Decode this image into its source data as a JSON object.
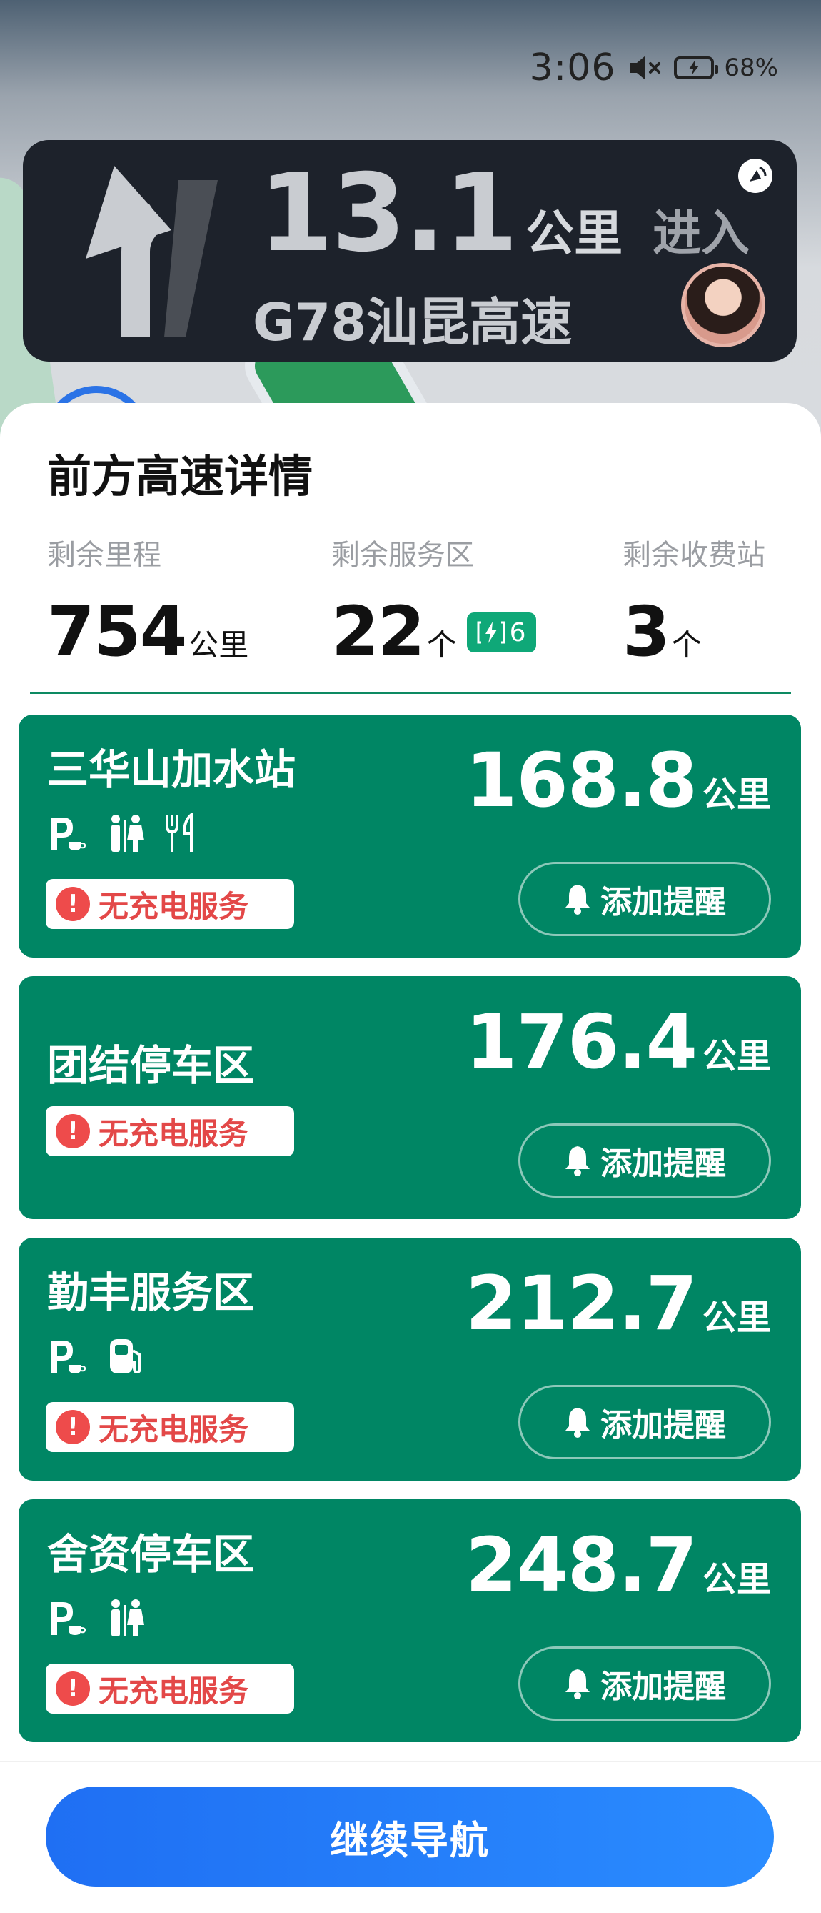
{
  "status_bar": {
    "time": "3:06",
    "battery_percent": "68%"
  },
  "navigation": {
    "distance_value": "13.1",
    "distance_unit": "公里",
    "action": "进入",
    "road_name": "G78汕昆高速",
    "turn_icon": "turn-left-arrow-icon"
  },
  "sheet": {
    "title": "前方高速详情",
    "stats": [
      {
        "label": "剩余里程",
        "value": "754",
        "unit": "公里"
      },
      {
        "label": "剩余服务区",
        "value": "22",
        "unit": "个",
        "charging_count": "6"
      },
      {
        "label": "剩余收费站",
        "value": "3",
        "unit": "个"
      }
    ]
  },
  "stations": [
    {
      "name": "三华山加水站",
      "distance": "168.8",
      "unit": "公里",
      "facilities": [
        "parking-icon",
        "restroom-icon",
        "restaurant-icon"
      ],
      "charge_status": "无充电服务",
      "remind_label": "添加提醒"
    },
    {
      "name": "团结停车区",
      "distance": "176.4",
      "unit": "公里",
      "facilities": [],
      "charge_status": "无充电服务",
      "remind_label": "添加提醒"
    },
    {
      "name": "勤丰服务区",
      "distance": "212.7",
      "unit": "公里",
      "facilities": [
        "parking-icon",
        "gas-station-icon"
      ],
      "charge_status": "无充电服务",
      "remind_label": "添加提醒"
    },
    {
      "name": "舍资停车区",
      "distance": "248.7",
      "unit": "公里",
      "facilities": [
        "parking-icon",
        "restroom-icon"
      ],
      "charge_status": "无充电服务",
      "remind_label": "添加提醒"
    }
  ],
  "footer": {
    "continue_label": "继续导航"
  },
  "colors": {
    "card_green": "#008664",
    "badge_green": "#0fa878",
    "warning_red": "#e34848",
    "primary_blue": "#1f6ff3"
  }
}
